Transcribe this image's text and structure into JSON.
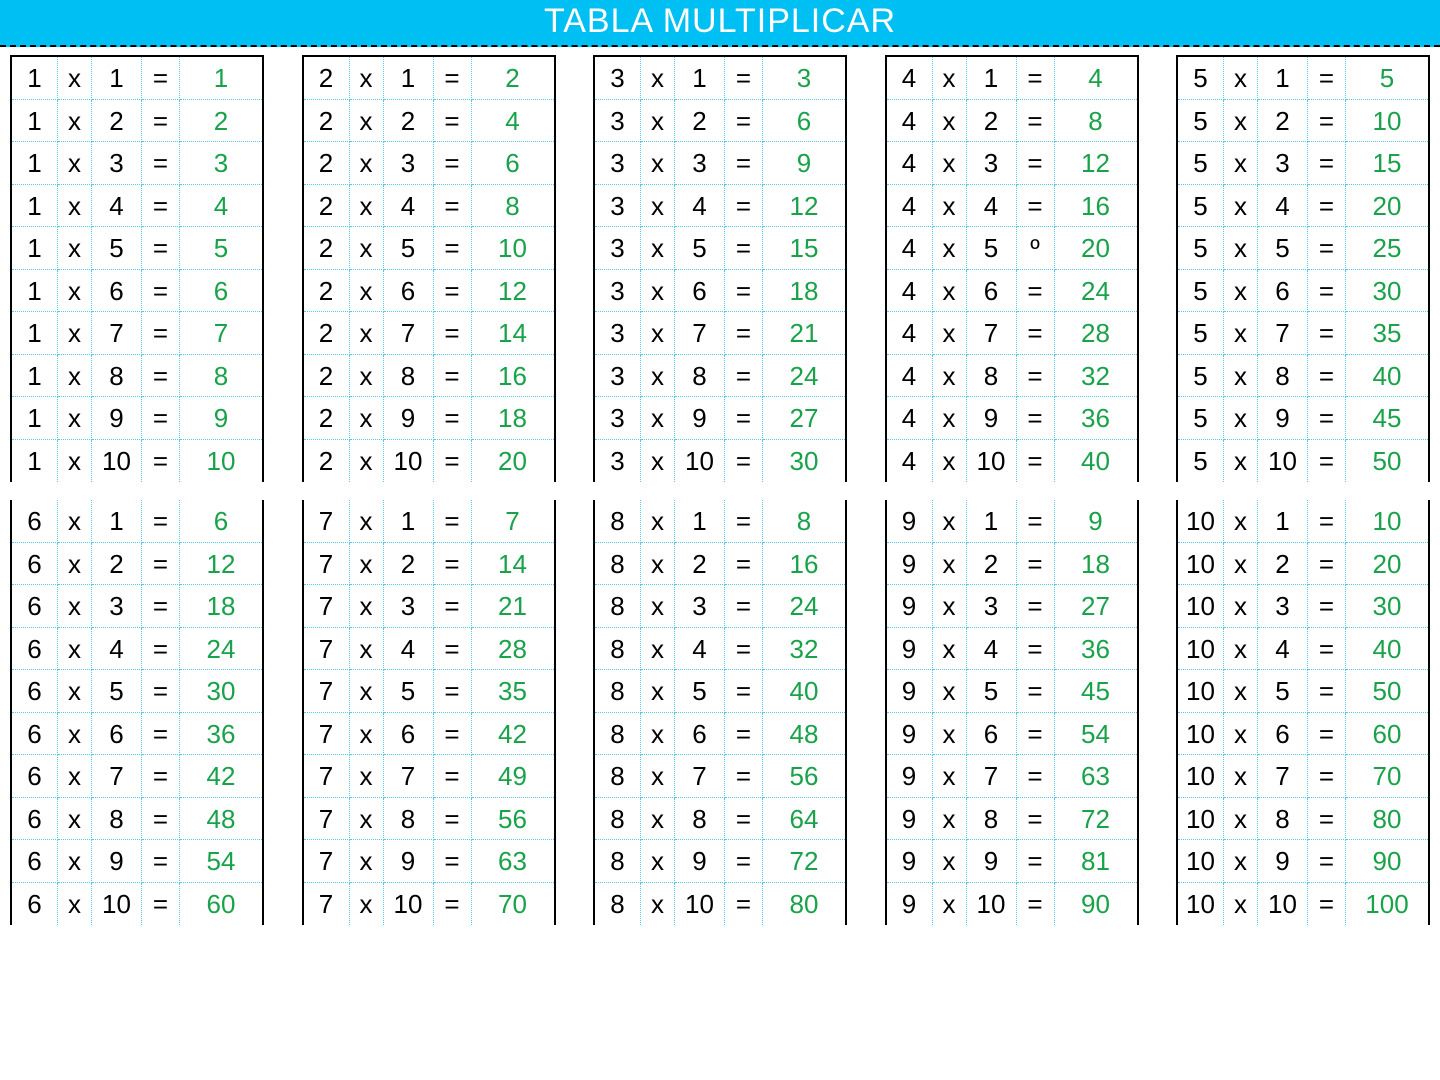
{
  "title": "TABLA MULTIPLICAR",
  "symbols": {
    "times": "x",
    "equals": "="
  },
  "colors": {
    "header_bg": "#00bff3",
    "result": "#19a24a",
    "cell_border": "#53c7ec"
  },
  "special_eq": {
    "block": 4,
    "row": 5,
    "symbol": "º"
  },
  "tables": [
    {
      "n": 1,
      "rows": [
        [
          1,
          1,
          1
        ],
        [
          1,
          2,
          2
        ],
        [
          1,
          3,
          3
        ],
        [
          1,
          4,
          4
        ],
        [
          1,
          5,
          5
        ],
        [
          1,
          6,
          6
        ],
        [
          1,
          7,
          7
        ],
        [
          1,
          8,
          8
        ],
        [
          1,
          9,
          9
        ],
        [
          1,
          10,
          10
        ]
      ]
    },
    {
      "n": 2,
      "rows": [
        [
          2,
          1,
          2
        ],
        [
          2,
          2,
          4
        ],
        [
          2,
          3,
          6
        ],
        [
          2,
          4,
          8
        ],
        [
          2,
          5,
          10
        ],
        [
          2,
          6,
          12
        ],
        [
          2,
          7,
          14
        ],
        [
          2,
          8,
          16
        ],
        [
          2,
          9,
          18
        ],
        [
          2,
          10,
          20
        ]
      ]
    },
    {
      "n": 3,
      "rows": [
        [
          3,
          1,
          3
        ],
        [
          3,
          2,
          6
        ],
        [
          3,
          3,
          9
        ],
        [
          3,
          4,
          12
        ],
        [
          3,
          5,
          15
        ],
        [
          3,
          6,
          18
        ],
        [
          3,
          7,
          21
        ],
        [
          3,
          8,
          24
        ],
        [
          3,
          9,
          27
        ],
        [
          3,
          10,
          30
        ]
      ]
    },
    {
      "n": 4,
      "rows": [
        [
          4,
          1,
          4
        ],
        [
          4,
          2,
          8
        ],
        [
          4,
          3,
          12
        ],
        [
          4,
          4,
          16
        ],
        [
          4,
          5,
          20
        ],
        [
          4,
          6,
          24
        ],
        [
          4,
          7,
          28
        ],
        [
          4,
          8,
          32
        ],
        [
          4,
          9,
          36
        ],
        [
          4,
          10,
          40
        ]
      ]
    },
    {
      "n": 5,
      "rows": [
        [
          5,
          1,
          5
        ],
        [
          5,
          2,
          10
        ],
        [
          5,
          3,
          15
        ],
        [
          5,
          4,
          20
        ],
        [
          5,
          5,
          25
        ],
        [
          5,
          6,
          30
        ],
        [
          5,
          7,
          35
        ],
        [
          5,
          8,
          40
        ],
        [
          5,
          9,
          45
        ],
        [
          5,
          10,
          50
        ]
      ]
    },
    {
      "n": 6,
      "rows": [
        [
          6,
          1,
          6
        ],
        [
          6,
          2,
          12
        ],
        [
          6,
          3,
          18
        ],
        [
          6,
          4,
          24
        ],
        [
          6,
          5,
          30
        ],
        [
          6,
          6,
          36
        ],
        [
          6,
          7,
          42
        ],
        [
          6,
          8,
          48
        ],
        [
          6,
          9,
          54
        ],
        [
          6,
          10,
          60
        ]
      ]
    },
    {
      "n": 7,
      "rows": [
        [
          7,
          1,
          7
        ],
        [
          7,
          2,
          14
        ],
        [
          7,
          3,
          21
        ],
        [
          7,
          4,
          28
        ],
        [
          7,
          5,
          35
        ],
        [
          7,
          6,
          42
        ],
        [
          7,
          7,
          49
        ],
        [
          7,
          8,
          56
        ],
        [
          7,
          9,
          63
        ],
        [
          7,
          10,
          70
        ]
      ]
    },
    {
      "n": 8,
      "rows": [
        [
          8,
          1,
          8
        ],
        [
          8,
          2,
          16
        ],
        [
          8,
          3,
          24
        ],
        [
          8,
          4,
          32
        ],
        [
          8,
          5,
          40
        ],
        [
          8,
          6,
          48
        ],
        [
          8,
          7,
          56
        ],
        [
          8,
          8,
          64
        ],
        [
          8,
          9,
          72
        ],
        [
          8,
          10,
          80
        ]
      ]
    },
    {
      "n": 9,
      "rows": [
        [
          9,
          1,
          9
        ],
        [
          9,
          2,
          18
        ],
        [
          9,
          3,
          27
        ],
        [
          9,
          4,
          36
        ],
        [
          9,
          5,
          45
        ],
        [
          9,
          6,
          54
        ],
        [
          9,
          7,
          63
        ],
        [
          9,
          8,
          72
        ],
        [
          9,
          9,
          81
        ],
        [
          9,
          10,
          90
        ]
      ]
    },
    {
      "n": 10,
      "rows": [
        [
          10,
          1,
          10
        ],
        [
          10,
          2,
          20
        ],
        [
          10,
          3,
          30
        ],
        [
          10,
          4,
          40
        ],
        [
          10,
          5,
          50
        ],
        [
          10,
          6,
          60
        ],
        [
          10,
          7,
          70
        ],
        [
          10,
          8,
          80
        ],
        [
          10,
          9,
          90
        ],
        [
          10,
          10,
          100
        ]
      ]
    }
  ]
}
